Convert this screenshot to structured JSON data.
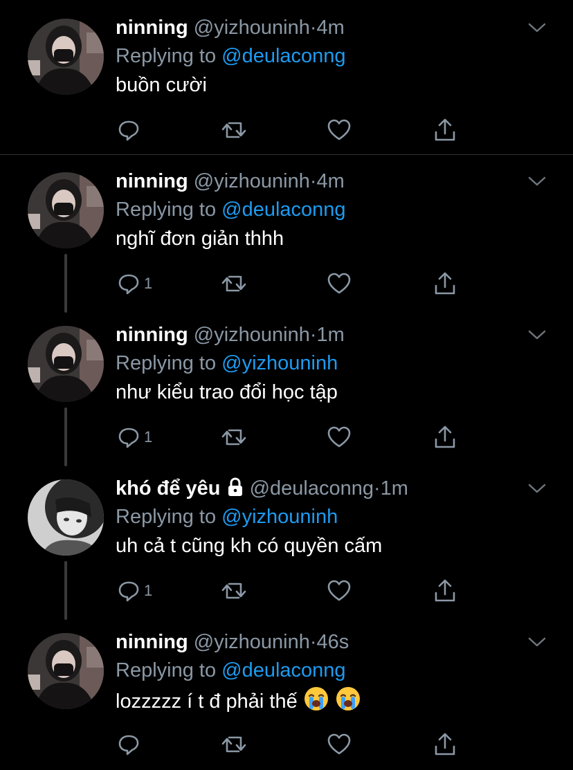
{
  "theme": {
    "background": "#000000",
    "text": "#ffffff",
    "muted": "#8b98a5",
    "link": "#1d9bf0",
    "divider": "#2f3336"
  },
  "tweets": [
    {
      "name": "ninning",
      "handle": "@yizhouninh",
      "dot": "·",
      "time": "4m",
      "reply_prefix": "Replying to",
      "reply_to": "@deulaconng",
      "text": "buồn cười",
      "reply_count": "",
      "locked": false,
      "emoji": []
    },
    {
      "name": "ninning",
      "handle": "@yizhouninh",
      "dot": "·",
      "time": "4m",
      "reply_prefix": "Replying to",
      "reply_to": "@deulaconng",
      "text": "nghĩ đơn giản thhh",
      "reply_count": "1",
      "locked": false,
      "emoji": []
    },
    {
      "name": "ninning",
      "handle": "@yizhouninh",
      "dot": "·",
      "time": "1m",
      "reply_prefix": "Replying to",
      "reply_to": "@yizhouninh",
      "text": "như kiểu trao đổi học tập",
      "reply_count": "1",
      "locked": false,
      "emoji": []
    },
    {
      "name": "khó để yêu",
      "handle": "@deulaconng",
      "dot": "·",
      "time": "1m",
      "reply_prefix": "Replying to",
      "reply_to": "@yizhouninh",
      "text": "uh cả t cũng kh có quyền cấm",
      "reply_count": "1",
      "locked": true,
      "emoji": []
    },
    {
      "name": "ninning",
      "handle": "@yizhouninh",
      "dot": "·",
      "time": "46s",
      "reply_prefix": "Replying to",
      "reply_to": "@deulaconng",
      "text": "lozzzzz í t đ phải thế",
      "reply_count": "",
      "locked": false,
      "emoji": [
        "loudly-crying-face",
        "loudly-crying-face"
      ]
    }
  ],
  "icons": {
    "reply": "reply-icon",
    "retweet": "retweet-icon",
    "like": "heart-icon",
    "share": "share-icon",
    "more": "chevron-down-icon",
    "lock": "lock-icon"
  }
}
